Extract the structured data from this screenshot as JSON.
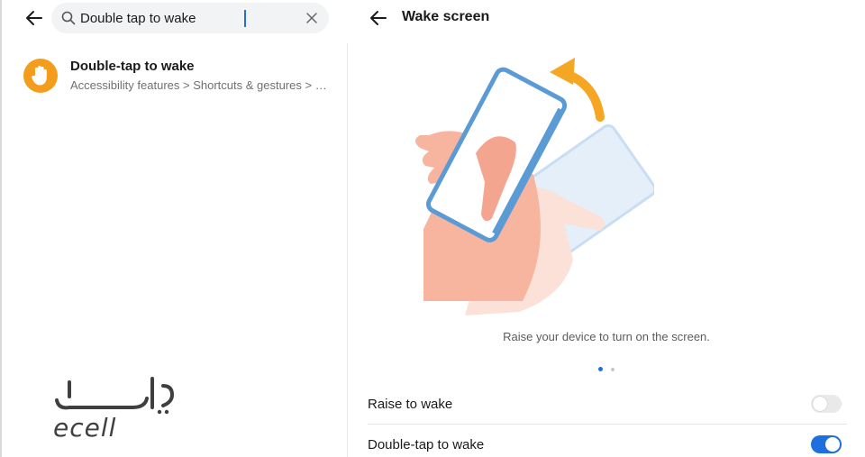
{
  "left_pane": {
    "search": {
      "value": "Double tap to wake",
      "placeholder": ""
    },
    "result": {
      "title": "Double-tap to wake",
      "path": "Accessibility features > Shortcuts & gestures > Double-tap to wake",
      "icon": "hand-icon"
    },
    "watermark": {
      "logo_text": "ecell"
    }
  },
  "right_pane": {
    "title": "Wake screen",
    "caption": "Raise your device to turn on the screen.",
    "carousel": {
      "page": 1,
      "total": 2
    },
    "settings": [
      {
        "label": "Raise to wake",
        "enabled": false
      },
      {
        "label": "Double-tap to wake",
        "enabled": true
      }
    ]
  },
  "colors": {
    "accent": "#1f6fdc",
    "result_icon": "#f49c1c",
    "arrow": "#f5a623",
    "phone_outline": "#5b9bd5",
    "hand": "#f7b5a0"
  }
}
